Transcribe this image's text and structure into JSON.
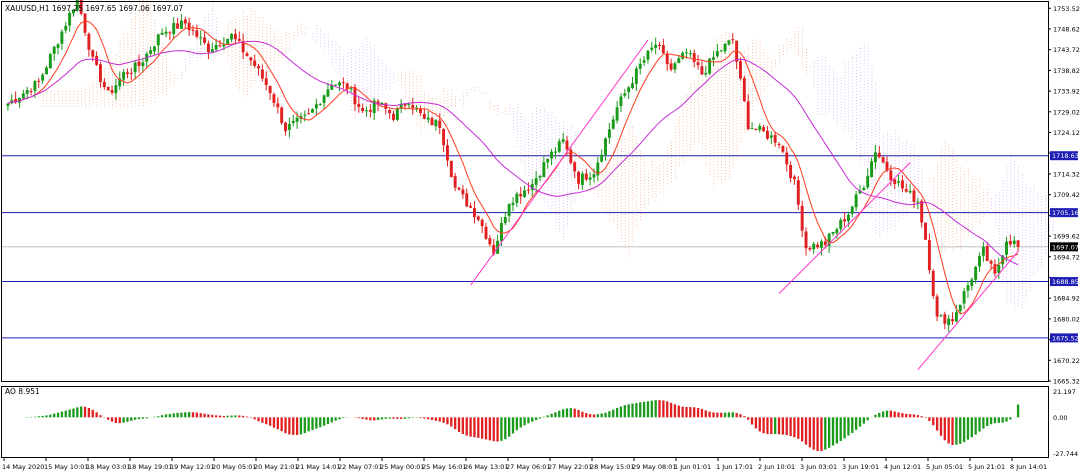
{
  "main_title": "XAUUSD,H1  1697.25 1697.65 1697.06 1697.07",
  "ao_title": "AO 8.951",
  "chart_data": [
    {
      "type": "candlestick",
      "symbol": "XAUUSD",
      "timeframe": "H1",
      "ohlc_header": {
        "open": 1697.25,
        "high": 1697.65,
        "low": 1697.06,
        "close": 1697.07
      },
      "ylim": [
        1665.32,
        1755.0
      ],
      "y_ticks": [
        1753.52,
        1748.62,
        1743.72,
        1738.82,
        1733.92,
        1729.02,
        1724.12,
        1719.22,
        1714.32,
        1709.42,
        1704.52,
        1699.62,
        1694.72,
        1689.82,
        1684.92,
        1680.02,
        1675.12,
        1670.22,
        1665.32
      ],
      "y_tick_labels": [
        "1753.52",
        "1748.62",
        "1743.72",
        "1738.82",
        "1733.92",
        "1729.02",
        "1724.12",
        "",
        "1714.32",
        "1709.42",
        "",
        "1699.62",
        "1694.72",
        "",
        "1684.92",
        "1680.02",
        "",
        "1670.22",
        "1665.32"
      ],
      "x_tick_labels": [
        "14 May 2020",
        "15 May 10:01",
        "18 May 03:01",
        "18 May 19:01",
        "19 May 12:01",
        "20 May 05:01",
        "20 May 21:01",
        "21 May 14:01",
        "22 May 07:01",
        "25 May 00:01",
        "25 May 16:01",
        "26 May 13:01",
        "27 May 06:01",
        "27 May 22:01",
        "28 May 15:01",
        "29 May 08:01",
        "1 Jun 01:01",
        "1 Jun 17:01",
        "2 Jun 10:01",
        "3 Jun 03:01",
        "3 Jun 19:01",
        "4 Jun 12:01",
        "5 Jun 05:01",
        "5 Jun 21:01",
        "8 Jun 14:01"
      ],
      "price_path": [
        [
          0,
          1731
        ],
        [
          8,
          1736
        ],
        [
          14,
          1748
        ],
        [
          18,
          1756
        ],
        [
          22,
          1741
        ],
        [
          26,
          1733
        ],
        [
          30,
          1738
        ],
        [
          34,
          1740
        ],
        [
          40,
          1748
        ],
        [
          46,
          1750
        ],
        [
          52,
          1744
        ],
        [
          58,
          1747
        ],
        [
          64,
          1740
        ],
        [
          68,
          1734
        ],
        [
          72,
          1725
        ],
        [
          78,
          1728
        ],
        [
          84,
          1736
        ],
        [
          88,
          1735
        ],
        [
          92,
          1729
        ],
        [
          96,
          1731
        ],
        [
          100,
          1728
        ],
        [
          104,
          1732
        ],
        [
          108,
          1727
        ],
        [
          112,
          1726
        ],
        [
          116,
          1711
        ],
        [
          122,
          1704
        ],
        [
          126,
          1696
        ],
        [
          130,
          1708
        ],
        [
          136,
          1712
        ],
        [
          140,
          1718
        ],
        [
          144,
          1722
        ],
        [
          148,
          1713
        ],
        [
          152,
          1715
        ],
        [
          158,
          1730
        ],
        [
          164,
          1740
        ],
        [
          168,
          1745
        ],
        [
          172,
          1739
        ],
        [
          176,
          1743
        ],
        [
          180,
          1738
        ],
        [
          184,
          1743
        ],
        [
          188,
          1746
        ],
        [
          192,
          1726
        ],
        [
          196,
          1724
        ],
        [
          200,
          1722
        ],
        [
          204,
          1712
        ],
        [
          207,
          1697
        ],
        [
          212,
          1698
        ],
        [
          218,
          1705
        ],
        [
          222,
          1712
        ],
        [
          225,
          1720
        ],
        [
          229,
          1714
        ],
        [
          233,
          1710
        ],
        [
          236,
          1708
        ],
        [
          238,
          1699
        ],
        [
          241,
          1680
        ],
        [
          245,
          1680
        ],
        [
          249,
          1688
        ],
        [
          253,
          1696
        ],
        [
          256,
          1690
        ],
        [
          259,
          1699
        ],
        [
          261,
          1698
        ],
        [
          262,
          1697.07
        ]
      ],
      "moving_averages": [
        {
          "name": "red",
          "color": "#ff3b1f",
          "period": 8
        },
        {
          "name": "violet",
          "color": "#c52cd6",
          "period": 30
        }
      ],
      "horizontal_levels": [
        {
          "value": 1718.63,
          "label": "1718.63",
          "color": "#1e1eb4"
        },
        {
          "value": 1705.16,
          "label": "1705.16",
          "color": "#1e1eb4"
        },
        {
          "value": 1688.85,
          "label": "1688.85",
          "color": "#1e1eb4"
        },
        {
          "value": 1675.52,
          "label": "1675.52",
          "color": "#1e1eb4"
        },
        {
          "value": 1697.07,
          "label": "1697.07",
          "color": "#000000",
          "style": "current"
        }
      ],
      "trendlines": [
        {
          "from": [
            1027,
            1688
          ],
          "to": [
            1044,
            1746
          ],
          "color": "#ff33cc"
        },
        {
          "from": [
            1028,
            1686
          ],
          "to": [
            1043,
            1717
          ],
          "color": "#ff33cc"
        },
        {
          "from": [
            1030,
            1668
          ],
          "to": [
            1036,
            1696
          ],
          "color": "#ff33cc"
        }
      ],
      "colors": {
        "bull": "#1a9a1a",
        "bear": "#e02020",
        "ichimoku_a": "#f0a070",
        "ichimoku_b": "#c8a0e8"
      },
      "grid": false
    },
    {
      "type": "bar",
      "name": "AO",
      "value": 8.951,
      "ylim": [
        -27.744,
        21.197
      ],
      "y_tick_labels": [
        "21.197",
        "0.00",
        "-27.744"
      ],
      "colors": {
        "up": "#1a9a1a",
        "down": "#e02020"
      },
      "grid": false
    }
  ]
}
